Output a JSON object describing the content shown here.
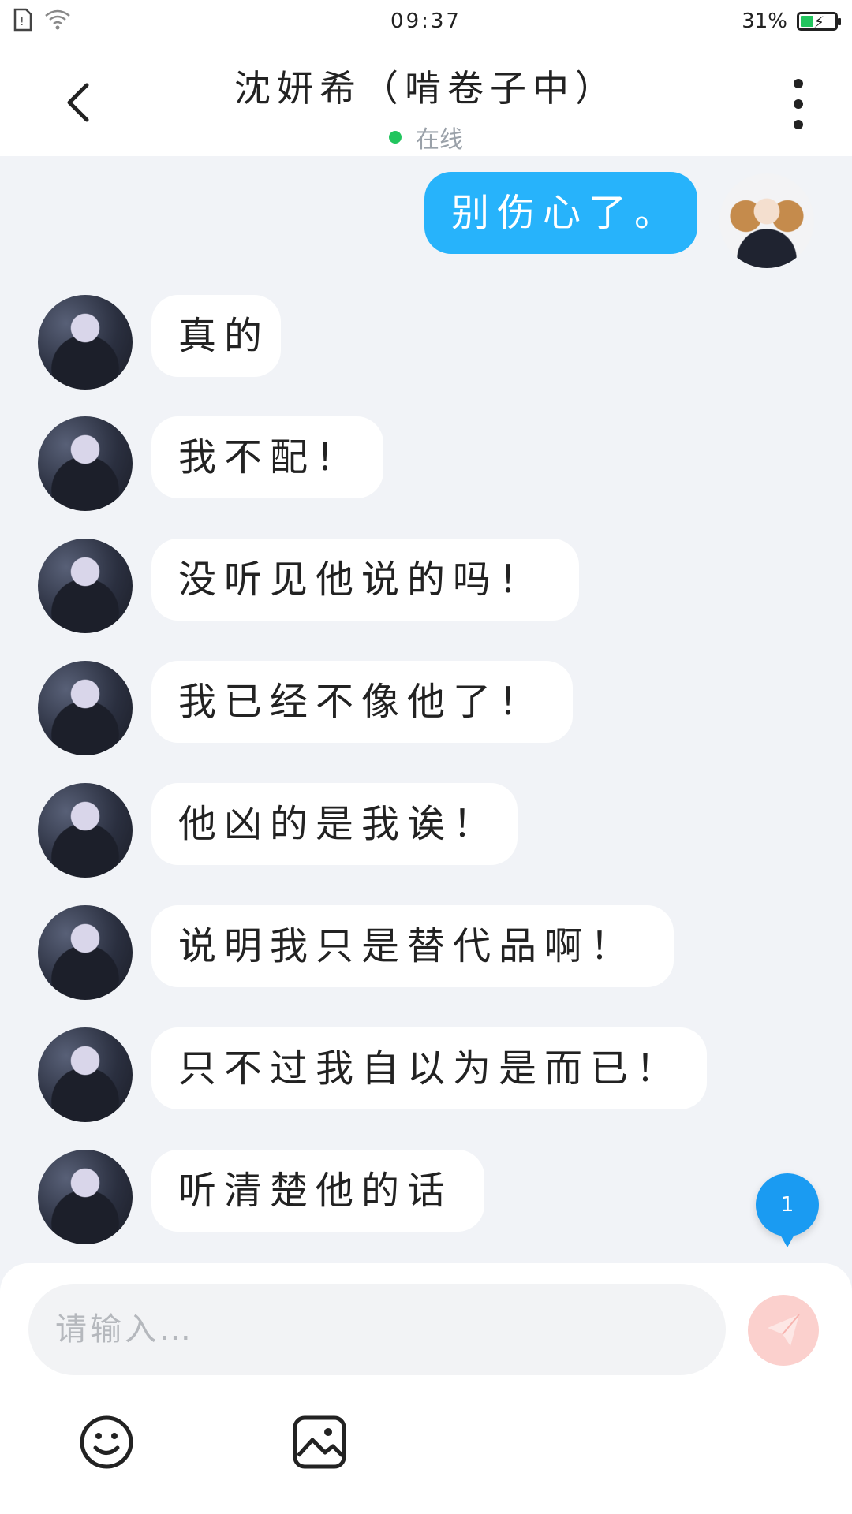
{
  "status_bar": {
    "time": "09:37",
    "battery": "31%"
  },
  "header": {
    "title": "沈妍希（啃卷子中）",
    "status": "在线"
  },
  "messages": [
    {
      "sender": "self",
      "text": "别伤心了。"
    },
    {
      "sender": "other",
      "text": "真的"
    },
    {
      "sender": "other",
      "text": "我不配！"
    },
    {
      "sender": "other",
      "text": "没听见他说的吗！"
    },
    {
      "sender": "other",
      "text": "我已经不像他了！"
    },
    {
      "sender": "other",
      "text": "他凶的是我诶！"
    },
    {
      "sender": "other",
      "text": "说明我只是替代品啊！"
    },
    {
      "sender": "other",
      "text": "只不过我自以为是而已！"
    },
    {
      "sender": "other",
      "text": "听清楚他的话"
    }
  ],
  "unread_badge": "1",
  "composer": {
    "placeholder": "请输入…"
  },
  "colors": {
    "self_bubble": "#27b3fb",
    "other_bubble": "#ffffff",
    "online_dot": "#22c55e",
    "send_button": "#fbd0cd"
  }
}
